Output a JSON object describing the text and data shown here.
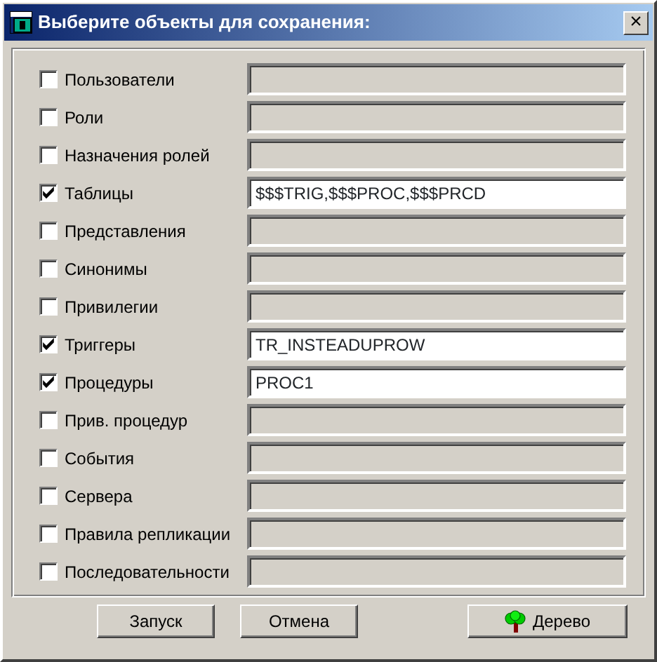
{
  "window": {
    "title": "Выберите объекты для сохранения:",
    "close": "×"
  },
  "objects": [
    {
      "label": "Пользователи",
      "checked": false
    },
    {
      "label": "Роли",
      "checked": false
    },
    {
      "label": "Назначения ролей",
      "checked": false
    },
    {
      "label": "Таблицы",
      "checked": true,
      "value": "$$$TRIG,$$$PROC,$$$PRCD"
    },
    {
      "label": "Представления",
      "checked": false
    },
    {
      "label": "Синонимы",
      "checked": false
    },
    {
      "label": "Привилегии",
      "checked": false
    },
    {
      "label": "Триггеры",
      "checked": true,
      "value": "TR_INSTEADUPROW"
    },
    {
      "label": "Процедуры",
      "checked": true,
      "value": "PROC1"
    },
    {
      "label": "Прив. процедур",
      "checked": false
    },
    {
      "label": "События",
      "checked": false
    },
    {
      "label": "Сервера",
      "checked": false
    },
    {
      "label": "Правила репликации",
      "checked": false
    },
    {
      "label": "Последовательности",
      "checked": false
    }
  ],
  "buttons": [
    {
      "label": "Запуск",
      "kind": "plain"
    },
    {
      "label": "Отмена",
      "kind": "plain"
    },
    {
      "label": "Дерево",
      "kind": "tree"
    }
  ]
}
